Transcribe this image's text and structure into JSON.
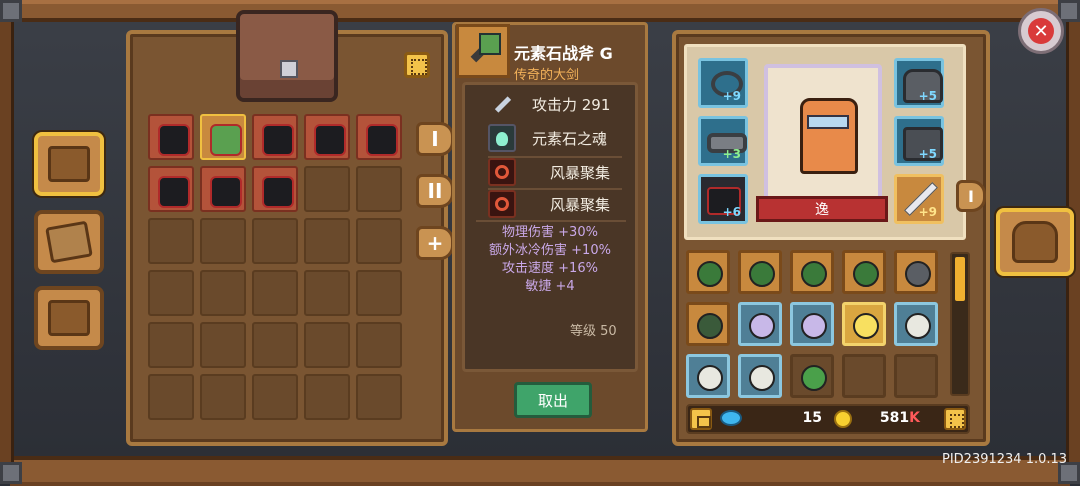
{
  "item": {
    "name": "元素石战斧 G",
    "subtitle": "传奇的大剑",
    "attack_label": "攻击力 291",
    "gems": [
      {
        "label": "元素石之魂",
        "icon": "spirit-gem-icon"
      },
      {
        "label": "风暴聚集",
        "icon": "storm-rune-icon"
      },
      {
        "label": "风暴聚集",
        "icon": "storm-rune-icon"
      }
    ],
    "bonuses": [
      "物理伤害 +30%",
      "额外冰冷伤害 +10%",
      "攻击速度 +16%",
      "敏捷 +4"
    ],
    "level_label": "等级 50",
    "take_out_label": "取出"
  },
  "tabs": [
    "I",
    "II",
    "+"
  ],
  "character": {
    "name": "逸",
    "slots": [
      {
        "icon": "ring-icon",
        "badge": "+9"
      },
      {
        "icon": "belt-icon",
        "badge": "+3"
      },
      {
        "icon": "boots-icon",
        "badge": "+6"
      },
      {
        "icon": "helmet-icon",
        "badge": "+5"
      },
      {
        "icon": "chest-armor-icon",
        "badge": "+5"
      },
      {
        "icon": "sword-icon",
        "badge": "+9"
      }
    ]
  },
  "currency": {
    "gems": "15",
    "gold": "581",
    "gold_suffix": "K"
  },
  "footer": {
    "build_label": "PID2391234 1.0.13"
  },
  "colors": {
    "accent_gold": "#f0c040",
    "wood": "#8a5a32",
    "take_button": "#3fa46a",
    "bonus_text": "#c9a8e8"
  }
}
